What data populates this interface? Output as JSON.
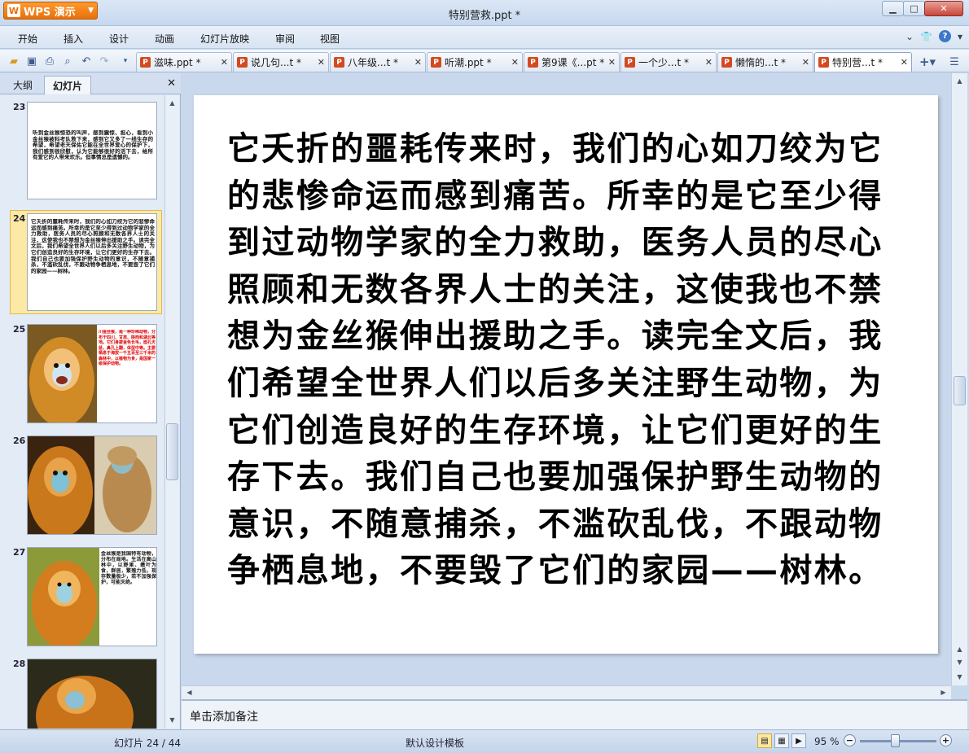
{
  "app": {
    "brand": "WPS 演示",
    "window_title": "特别营救.ppt *"
  },
  "menu": [
    "开始",
    "插入",
    "设计",
    "动画",
    "幻灯片放映",
    "审阅",
    "视图"
  ],
  "doc_tabs": [
    {
      "label": "滋味.ppt *",
      "active": false
    },
    {
      "label": "说几句...t *",
      "active": false
    },
    {
      "label": "八年级...t *",
      "active": false
    },
    {
      "label": "听潮.ppt *",
      "active": false
    },
    {
      "label": "第9课《...pt *",
      "active": false
    },
    {
      "label": "一个少...t *",
      "active": false
    },
    {
      "label": "懒惰的...t *",
      "active": false
    },
    {
      "label": "特别营...t *",
      "active": true
    }
  ],
  "left_panel": {
    "tabs": [
      "大纲",
      "幻灯片"
    ],
    "active_tab": "幻灯片",
    "slides": [
      {
        "num": "23",
        "text": "听到金丝猴惊恐的叫声，感到震惊、担心，看到小金丝猴被科考队救下来，感到它又多了一线生存的希望，希望老天保佑它能在全世界爱心的保护下，我们感到很欣慰，认为它能够很好的活下去，给所有爱它的人带来欢乐。但事情总是遗憾的。"
      },
      {
        "num": "24",
        "text": "它夭折的噩耗传来时，我们的心如刀绞为它的悲惨命运而感到痛苦。所幸的是它至少得到过动物学家的全力救助，医务人员的尽心照顾和无数各界人士的关注，这使我也不禁想为金丝猴伸出援助之手。读完全文后，我们希望全世界人们以后多关注野生动物，为它们创造良好的生存环境，让它们更好的生存下去。我们自己也要加强保护野生动物的意识，不随意捕杀，不滥砍乱伐，不跟动物争栖息地，不要毁了它们的家园——树林。"
      },
      {
        "num": "25",
        "text": "川金丝猴，是一种珍稀动物，分布于四川、甘肃、陕西和湖北等地。它们身披金色长毛，面孔天蓝，鼻孔上翻，体型中等。主要栖息于海拔一千五百至三千米的森林中，以植物为食，是国家一级保护动物。"
      },
      {
        "num": "26",
        "text": ""
      },
      {
        "num": "27",
        "text": "金丝猴是我国特有动物，分布在局地。生活在高山林中，以野果、嫩叶为食，群居，繁殖力低，现存数量极少，若不加强保护，可能灭绝。"
      },
      {
        "num": "28",
        "text": ""
      }
    ]
  },
  "slide": {
    "body": "它夭折的噩耗传来时，我们的心如刀绞为它的悲惨命运而感到痛苦。所幸的是它至少得到过动物学家的全力救助，医务人员的尽心照顾和无数各界人士的关注，这使我也不禁想为金丝猴伸出援助之手。读完全文后，我们希望全世界人们以后多关注野生动物，为它们创造良好的生存环境，让它们更好的生存下去。我们自己也要加强保护野生动物的意识，不随意捕杀，不滥砍乱伐，不跟动物争栖息地，不要毁了它们的家园——树林。"
  },
  "notes": {
    "placeholder": "单击添加备注"
  },
  "status": {
    "slide_counter": "幻灯片 24 / 44",
    "template": "默认设计模板",
    "zoom": "95 %"
  },
  "colors": {
    "brand_orange": "#e8700a",
    "selection_yellow": "#fde9a6",
    "thumb_red_text": "#e00000"
  }
}
